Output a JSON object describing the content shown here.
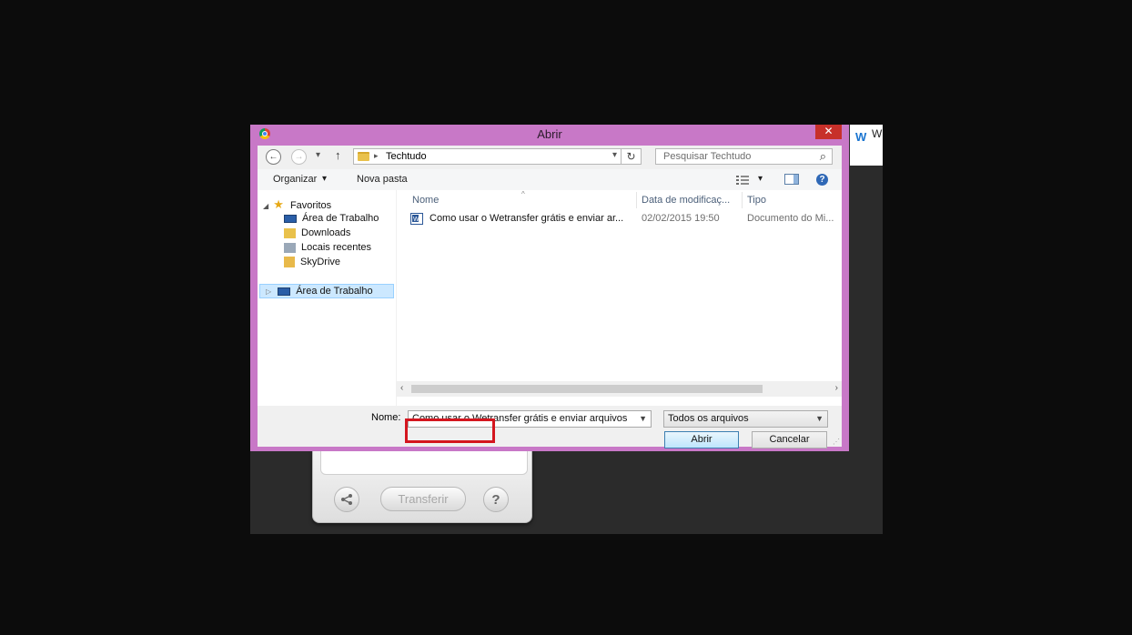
{
  "background": {
    "tab_text": "W",
    "transfer_button": "Transferir",
    "share_icon": "share-icon",
    "help_icon": "?"
  },
  "dialog": {
    "title": "Abrir",
    "close_glyph": "✕",
    "nav": {
      "back": "←",
      "forward": "→",
      "recent": "▾",
      "up": "↑",
      "path_separator": "▸",
      "path": "Techtudo",
      "refresh": "↻",
      "search_placeholder": "Pesquisar Techtudo",
      "search_icon": "⌕"
    },
    "toolbar": {
      "organize": "Organizar",
      "organize_arrow": "▾",
      "new_folder": "Nova pasta"
    },
    "sidebar": {
      "favorites": "Favoritos",
      "items": [
        {
          "label": "Área de Trabalho",
          "icon": "desktop-icon"
        },
        {
          "label": "Downloads",
          "icon": "downloads-icon"
        },
        {
          "label": "Locais recentes",
          "icon": "recent-places-icon"
        },
        {
          "label": "SkyDrive",
          "icon": "skydrive-icon"
        }
      ],
      "desktop_root": "Área de Trabalho"
    },
    "columns": {
      "name": "Nome",
      "date": "Data de modificaç...",
      "type": "Tipo"
    },
    "files": [
      {
        "name": "Como usar o Wetransfer grátis e enviar ar...",
        "date": "02/02/2015 19:50",
        "type": "Documento do Mi..."
      }
    ],
    "bottom": {
      "name_label": "Nome:",
      "name_value": "Como usar o Wetransfer grátis e enviar arquivos",
      "filter": "Todos os arquivos",
      "open": "Abrir",
      "cancel": "Cancelar"
    },
    "accent_color": "#c878c7",
    "highlight_color": "#d4161f"
  }
}
